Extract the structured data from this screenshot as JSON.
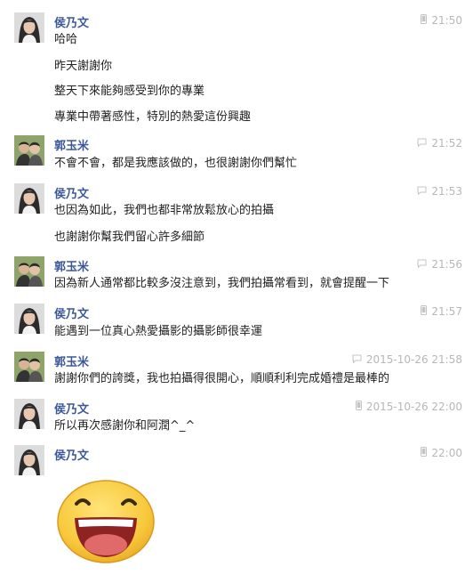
{
  "thread": {
    "messages": [
      {
        "sender": "侯乃文",
        "avatar": "woman-avatar",
        "device_icon": "phone-icon",
        "time": "21:50",
        "lines": [
          "哈哈",
          "昨天謝謝你",
          "整天下來能夠感受到你的專業",
          "專業中帶著感性，特別的熱愛這份興趣"
        ]
      },
      {
        "sender": "郭玉米",
        "avatar": "couple-avatar",
        "device_icon": "chat-icon",
        "time": "21:52",
        "lines": [
          "不會不會，都是我應該做的，也很謝謝你們幫忙"
        ]
      },
      {
        "sender": "侯乃文",
        "avatar": "woman-avatar",
        "device_icon": "chat-icon",
        "time": "21:53",
        "lines": [
          "也因為如此，我們也都非常放鬆放心的拍攝",
          "也謝謝你幫我們留心許多細節"
        ]
      },
      {
        "sender": "郭玉米",
        "avatar": "couple-avatar",
        "device_icon": "chat-icon",
        "time": "21:56",
        "lines": [
          "因為新人通常都比較多沒注意到，我們拍攝常看到，就會提醒一下"
        ]
      },
      {
        "sender": "侯乃文",
        "avatar": "woman-avatar",
        "device_icon": "phone-icon",
        "time": "21:57",
        "lines": [
          "能遇到一位真心熱愛攝影的攝影師很幸運"
        ]
      },
      {
        "sender": "郭玉米",
        "avatar": "couple-avatar",
        "device_icon": "chat-icon",
        "time": "2015-10-26 21:58",
        "lines": [
          "謝謝你們的誇獎，我也拍攝得很開心，順順利利完成婚禮是最棒的"
        ]
      },
      {
        "sender": "侯乃文",
        "avatar": "woman-avatar",
        "device_icon": "phone-icon",
        "time": "2015-10-26 22:00",
        "lines": [
          "所以再次感謝你和阿潤^_^"
        ]
      },
      {
        "sender": "侯乃文",
        "avatar": "woman-avatar",
        "device_icon": "phone-icon",
        "time": "22:00",
        "lines": [],
        "sticker": "laughing-face-sticker"
      }
    ]
  },
  "colors": {
    "sender": "#3b5998",
    "meta": "#b7b7b7",
    "text": "#222222",
    "sticker_face": "#f7c83b",
    "sticker_mouth": "#c64a46"
  }
}
